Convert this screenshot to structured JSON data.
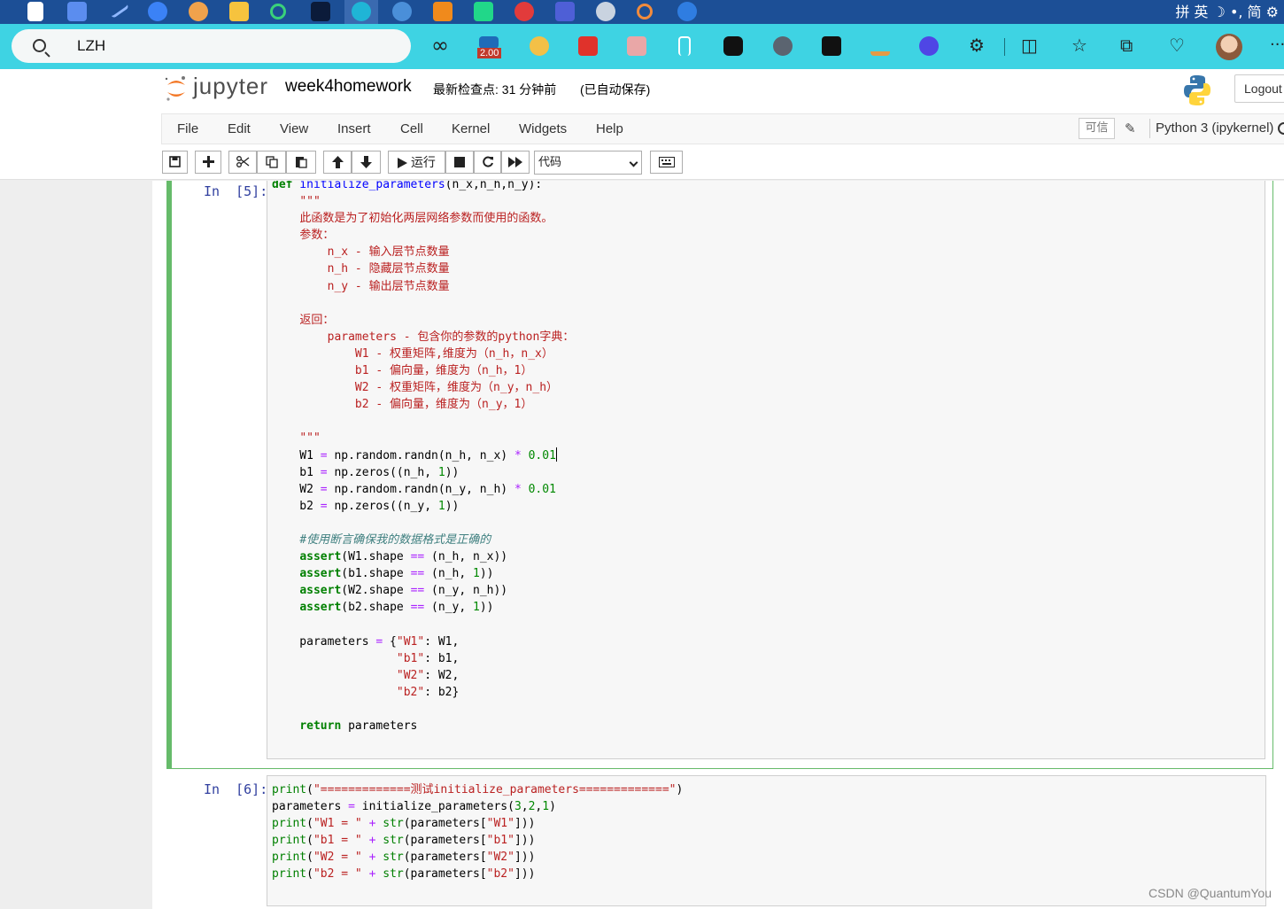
{
  "taskbar": {
    "ime": "拼 英 ☽ •, 简 ⚙"
  },
  "browser": {
    "address": "LZH",
    "extension_badge": "2.00",
    "extensions": [
      "infinity-icon",
      "version-icon",
      "sphere-icon",
      "fe-icon",
      "reader-icon",
      "bookmark-icon",
      "panda-icon",
      "globe-icon",
      "exclaim-icon",
      "plant-icon",
      "orb-icon",
      "puzzle-icon",
      "split-screen-icon",
      "favorites-icon",
      "collections-icon",
      "health-icon",
      "avatar",
      "more-icon"
    ]
  },
  "header": {
    "logo_text": "jupyter",
    "notebook_name": "week4homework",
    "checkpoint": "最新检查点: 31 分钟前",
    "autosave": "(已自动保存)",
    "logout": "Logout"
  },
  "menu": {
    "items": [
      "File",
      "Edit",
      "View",
      "Insert",
      "Cell",
      "Kernel",
      "Widgets",
      "Help"
    ],
    "trusted": "可信",
    "kernel": "Python 3 (ipykernel)"
  },
  "toolbar": {
    "run": "运行",
    "cell_type": "代码"
  },
  "cells": {
    "cell5": {
      "prompt": "In  [5]:"
    },
    "cell6": {
      "prompt": "In  [6]:"
    }
  },
  "watermark": "CSDN @QuantumYou"
}
